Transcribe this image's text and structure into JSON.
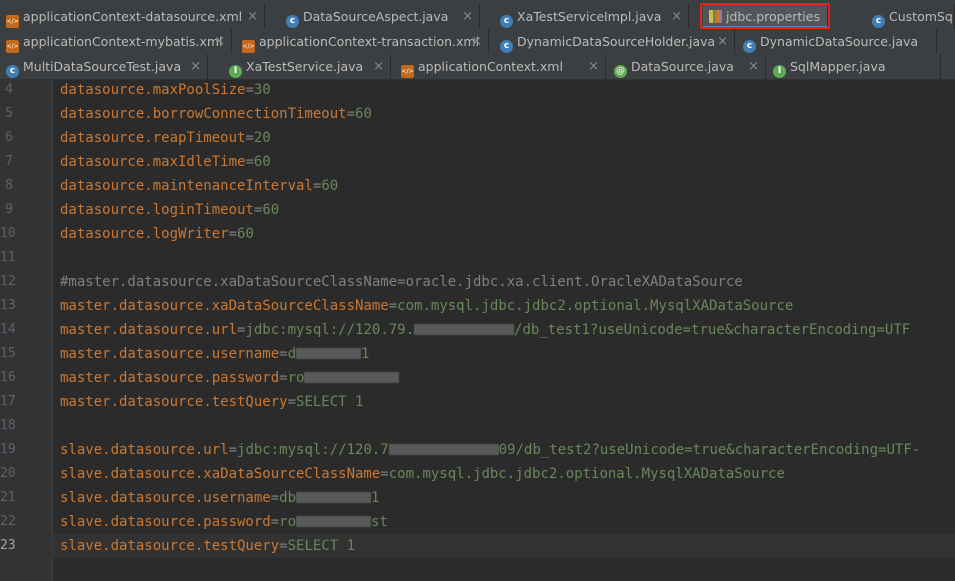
{
  "tabs": {
    "row1": [
      {
        "label": "applicationContext-datasource.xml",
        "icon": "xml-file-icon"
      },
      {
        "label": "DataSourceAspect.java",
        "icon": "class-icon"
      },
      {
        "label": "XaTestServiceImpl.java",
        "icon": "class-icon"
      },
      {
        "label": "jdbc.properties",
        "icon": "properties-file-icon"
      },
      {
        "label": "CustomSq",
        "icon": "class-icon"
      }
    ],
    "row2": [
      {
        "label": "applicationContext-mybatis.xml",
        "icon": "xml-file-icon"
      },
      {
        "label": "applicationContext-transaction.xml",
        "icon": "xml-file-icon"
      },
      {
        "label": "DynamicDataSourceHolder.java",
        "icon": "class-icon"
      },
      {
        "label": "DynamicDataSource.java",
        "icon": "class-icon"
      }
    ],
    "row3": [
      {
        "label": "MultiDataSourceTest.java",
        "icon": "class-icon"
      },
      {
        "label": "XaTestService.java",
        "icon": "interface-icon"
      },
      {
        "label": "applicationContext.xml",
        "icon": "xml-file-icon"
      },
      {
        "label": "DataSource.java",
        "icon": "annotation-icon"
      },
      {
        "label": "SqlMapper.java",
        "icon": "interface-icon"
      }
    ],
    "close_glyph": "×",
    "active": "jdbc.properties"
  },
  "editor": {
    "current_line": "23",
    "lines": [
      {
        "n": "4",
        "key": "datasource.maxPoolSize",
        "eq": "=",
        "val": "30"
      },
      {
        "n": "5",
        "key": "datasource.borrowConnectionTimeout",
        "eq": "=",
        "val": "60"
      },
      {
        "n": "6",
        "key": "datasource.reapTimeout",
        "eq": "=",
        "val": "20"
      },
      {
        "n": "7",
        "key": "datasource.maxIdleTime",
        "eq": "=",
        "val": "60"
      },
      {
        "n": "8",
        "key": "datasource.maintenanceInterval",
        "eq": "=",
        "val": "60"
      },
      {
        "n": "9",
        "key": "datasource.loginTimeout",
        "eq": "=",
        "val": "60"
      },
      {
        "n": "10",
        "key": "datasource.logWriter",
        "eq": "=",
        "val": "60"
      },
      {
        "n": "11",
        "key": "",
        "eq": "",
        "val": ""
      },
      {
        "n": "12",
        "comment": "#master.datasource.xaDataSourceClassName=oracle.jdbc.xa.client.OracleXADataSource"
      },
      {
        "n": "13",
        "key": "master.datasource.xaDataSourceClassName",
        "eq": "=",
        "val": "com.mysql.jdbc.jdbc2.optional.MysqlXADataSource"
      },
      {
        "n": "14",
        "key": "master.datasource.url",
        "eq": "=",
        "val": "jdbc:mysql://120.79.",
        "redact": true,
        "val2": "/db_test1?useUnicode=true&characterEncoding=UTF"
      },
      {
        "n": "15",
        "key": "master.datasource.username",
        "eq": "=",
        "val": "d",
        "redact": true,
        "val2": "1"
      },
      {
        "n": "16",
        "key": "master.datasource.password",
        "eq": "=",
        "val": "ro",
        "redact": true,
        "val2": ""
      },
      {
        "n": "17",
        "key": "master.datasource.testQuery",
        "eq": "=",
        "val": "SELECT 1"
      },
      {
        "n": "18",
        "key": "",
        "eq": "",
        "val": ""
      },
      {
        "n": "19",
        "key": "slave.datasource.url",
        "eq": "=",
        "val": "jdbc:mysql://120.7",
        "redact": true,
        "val2": "09/db_test2?useUnicode=true&characterEncoding=UTF-"
      },
      {
        "n": "20",
        "key": "slave.datasource.xaDataSourceClassName",
        "eq": "=",
        "val": "com.mysql.jdbc.jdbc2.optional.MysqlXADataSource"
      },
      {
        "n": "21",
        "key": "slave.datasource.username",
        "eq": "=",
        "val": "db",
        "redact": true,
        "val2": "1"
      },
      {
        "n": "22",
        "key": "slave.datasource.password",
        "eq": "=",
        "val": "ro",
        "redact": true,
        "val2": "st"
      },
      {
        "n": "23",
        "key": "slave.datasource.testQuery",
        "eq": "=",
        "val": "SELECT 1"
      }
    ]
  }
}
